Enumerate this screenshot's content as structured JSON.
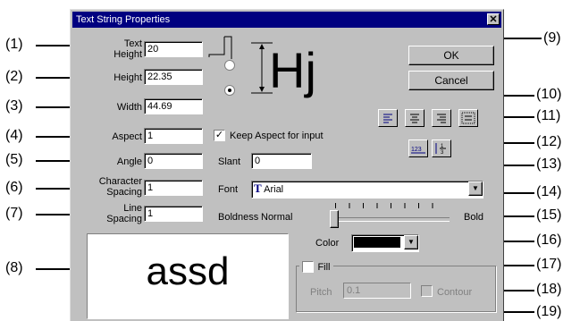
{
  "callouts": [
    "(1)",
    "(2)",
    "(3)",
    "(4)",
    "(5)",
    "(6)",
    "(7)",
    "(8)",
    "(9)",
    "(10)",
    "(11)",
    "(12)",
    "(13)",
    "(14)",
    "(15)",
    "(16)",
    "(17)",
    "(18)",
    "(19)"
  ],
  "dialog": {
    "title": "Text String Properties",
    "close_glyph": "✕",
    "fields": {
      "text_height": {
        "label_line1": "Text",
        "label_line2": "Height",
        "value": "20"
      },
      "height": {
        "label": "Height",
        "value": "22.35"
      },
      "width": {
        "label": "Width",
        "value": "44.69"
      },
      "aspect": {
        "label": "Aspect",
        "value": "1"
      },
      "angle": {
        "label": "Angle",
        "value": "0"
      },
      "char_spacing": {
        "label_line1": "Character",
        "label_line2": "Spacing",
        "value": "1"
      },
      "line_spacing": {
        "label_line1": "Line",
        "label_line2": "Spacing",
        "value": "1"
      }
    },
    "diagram_text": "Hj",
    "keep_aspect": {
      "label": "Keep Aspect for input",
      "checked": true
    },
    "slant": {
      "label": "Slant",
      "value": "0"
    },
    "font": {
      "label": "Font",
      "value": "Arial",
      "icon": "truetype-icon"
    },
    "boldness": {
      "label": "Boldness",
      "min_label": "Normal",
      "max_label": "Bold",
      "level": 0
    },
    "color": {
      "label": "Color",
      "value": "#000000"
    },
    "fill": {
      "label": "Fill",
      "checked": false
    },
    "pitch": {
      "label": "Pitch",
      "value": "0.1"
    },
    "contour": {
      "label": "Contour",
      "checked": false
    },
    "buttons": {
      "ok": "OK",
      "cancel": "Cancel"
    },
    "preview_text": "assd",
    "number_icon": "123"
  }
}
